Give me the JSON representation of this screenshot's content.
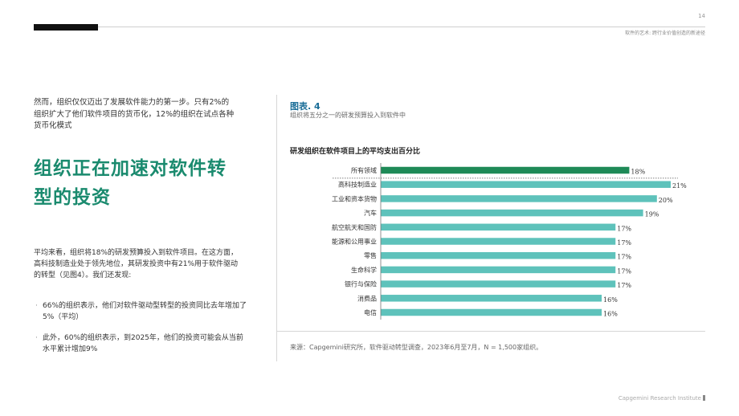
{
  "header": {
    "page_number": "14",
    "doc_subtitle": "软件的艺术: 跨行业价值创造的新途径"
  },
  "left": {
    "intro": "然而，组织仅仅迈出了发展软件能力的第一步。只有2%的组织扩大了他们软件项目的货币化，12%的组织在试点各种货币化模式",
    "headline": "组织正在加速对软件转型的投资",
    "paragraph": "平均来看，组织将18%的研发预算投入到软件项目。在这方面，高科技制造业处于领先地位，其研发投资中有21%用于软件驱动的转型（见图4）。我们还发现:",
    "bullets": [
      "66%的组织表示，他们对软件驱动型转型的投资同比去年增加了5%（平均）",
      "此外，60%的组织表示，到2025年，他们的投资可能会从当前水平累计增加9%"
    ]
  },
  "figure": {
    "label": "图表. 4",
    "caption": "组织将五分之一的研发预算投入到软件中",
    "source": "来源：Capgemini研究所，软件驱动转型调查，2023年6月至7月，N = 1,500家组织。"
  },
  "chart_data": {
    "type": "bar",
    "orientation": "horizontal",
    "title": "研发组织在软件项目上的平均支出百分比",
    "categories": [
      "所有领域",
      "高科技制造业",
      "工业和资本货物",
      "汽车",
      "航空航天和国防",
      "能源和公用事业",
      "零售",
      "生命科学",
      "银行与保险",
      "消费品",
      "电信"
    ],
    "values": [
      18,
      21,
      20,
      19,
      17,
      17,
      17,
      17,
      17,
      16,
      16
    ],
    "value_labels": [
      "18%",
      "21%",
      "20%",
      "19%",
      "17%",
      "17%",
      "17%",
      "17%",
      "17%",
      "16%",
      "16%"
    ],
    "xlim": [
      0,
      21
    ],
    "highlight_color": "#1e8a57",
    "bar_color": "#5ec2bb",
    "grid": false,
    "legend": "none"
  },
  "footer": {
    "brand": "Capgemini Research Institute"
  }
}
